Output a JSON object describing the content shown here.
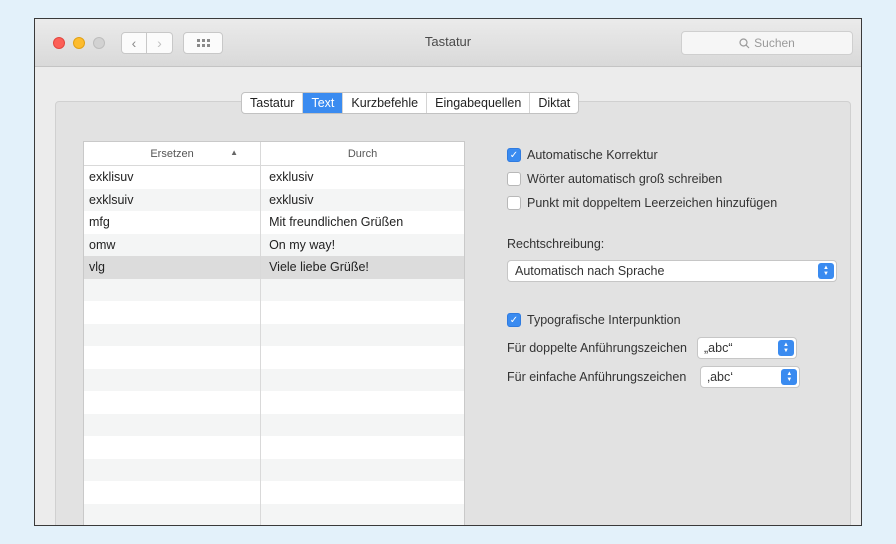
{
  "window": {
    "title": "Tastatur"
  },
  "search": {
    "placeholder": "Suchen"
  },
  "tabs": [
    {
      "label": "Tastatur",
      "active": false
    },
    {
      "label": "Text",
      "active": true
    },
    {
      "label": "Kurzbefehle",
      "active": false
    },
    {
      "label": "Eingabequellen",
      "active": false
    },
    {
      "label": "Diktat",
      "active": false
    }
  ],
  "table": {
    "col_replace": "Ersetzen",
    "col_with": "Durch",
    "rows": [
      {
        "replace": "exklisuv",
        "with": "exklusiv"
      },
      {
        "replace": "exklsuiv",
        "with": "exklusiv"
      },
      {
        "replace": "mfg",
        "with": "Mit freundlichen Grüßen"
      },
      {
        "replace": "omw",
        "with": "On my way!"
      },
      {
        "replace": "vlg",
        "with": "Viele liebe Grüße!",
        "selected": true
      }
    ]
  },
  "options": {
    "autocorrect": {
      "label": "Automatische Korrektur",
      "checked": true
    },
    "capitalize": {
      "label": "Wörter automatisch groß schreiben",
      "checked": false
    },
    "period": {
      "label": "Punkt mit doppeltem Leerzeichen hinzufügen",
      "checked": false
    },
    "spelling_label": "Rechtschreibung:",
    "spelling_value": "Automatisch nach Sprache",
    "typo": {
      "label": "Typografische Interpunktion",
      "checked": true
    },
    "double_quotes_label": "Für doppelte Anführungszeichen",
    "double_quotes_value": "„abc“",
    "single_quotes_label": "Für einfache Anführungszeichen",
    "single_quotes_value": "‚abc‘"
  },
  "colors": {
    "accent": "#3a8bf0"
  }
}
